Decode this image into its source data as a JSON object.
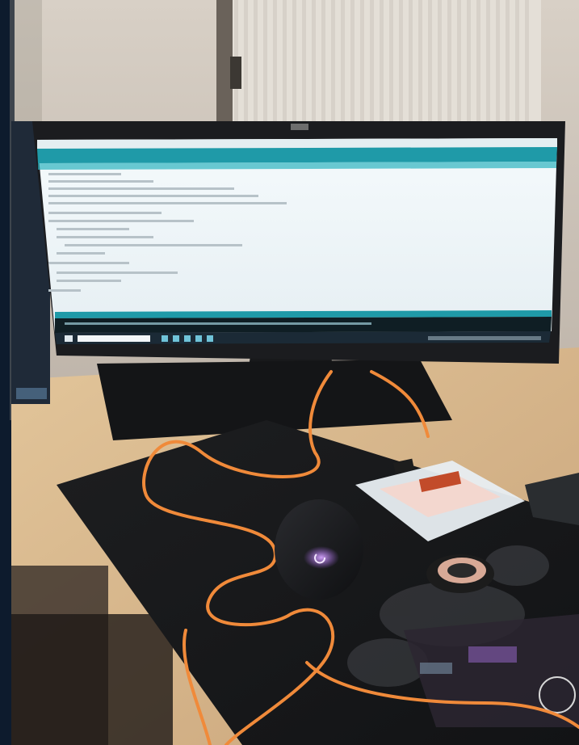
{
  "scene": {
    "subjects": [
      "monitor",
      "arduino-ide-screen",
      "mouse",
      "mousepad",
      "orange-usb-cable",
      "breadboard-kit",
      "electrical-tape",
      "electronics-board",
      "radiator",
      "desk"
    ],
    "colors": {
      "wall": "#cfc7bd",
      "radiator": "#e8e3dc",
      "desk": "#d9b98c",
      "monitor_bezel": "#1b1c1f",
      "ide_teal": "#1f9aa8",
      "ide_body": "#eef4f7",
      "ide_console": "#0f1e24",
      "taskbar": "#1b2a36",
      "mousepad": "#1a1b1d",
      "cable": "#f08a3a",
      "mouse_glow": "#b46cff",
      "tape": "#2b2b2b",
      "clear_box": "#e8eef2"
    }
  }
}
